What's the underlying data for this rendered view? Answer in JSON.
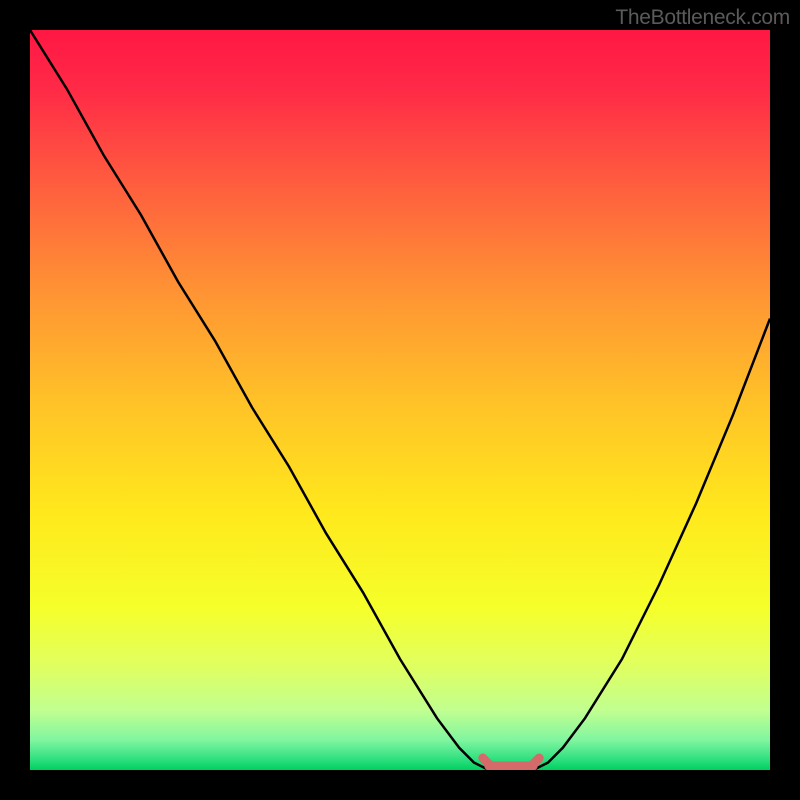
{
  "watermark": "TheBottleneck.com",
  "chart_data": {
    "type": "line",
    "title": "",
    "xlabel": "",
    "ylabel": "",
    "xlim": [
      0,
      100
    ],
    "ylim": [
      0,
      100
    ],
    "x": [
      0,
      5,
      10,
      15,
      20,
      25,
      30,
      35,
      40,
      45,
      50,
      55,
      58,
      60,
      62,
      64,
      66,
      68,
      70,
      72,
      75,
      80,
      85,
      90,
      95,
      100
    ],
    "y": [
      100,
      92,
      83,
      75,
      66,
      58,
      49,
      41,
      32,
      24,
      15,
      7,
      3,
      1,
      0,
      0,
      0,
      0,
      1,
      3,
      7,
      15,
      25,
      36,
      48,
      61
    ],
    "minimum_region": {
      "x_start": 62,
      "x_end": 68,
      "y": 0
    },
    "gradient_stops": [
      {
        "pos": 0.0,
        "color": "#ff1744"
      },
      {
        "pos": 0.08,
        "color": "#ff2a47"
      },
      {
        "pos": 0.2,
        "color": "#ff5a3f"
      },
      {
        "pos": 0.35,
        "color": "#ff9234"
      },
      {
        "pos": 0.5,
        "color": "#ffc128"
      },
      {
        "pos": 0.65,
        "color": "#ffe81c"
      },
      {
        "pos": 0.78,
        "color": "#f5ff2a"
      },
      {
        "pos": 0.86,
        "color": "#e0ff60"
      },
      {
        "pos": 0.92,
        "color": "#c0ff90"
      },
      {
        "pos": 0.96,
        "color": "#80f5a0"
      },
      {
        "pos": 0.985,
        "color": "#30e080"
      },
      {
        "pos": 1.0,
        "color": "#00d060"
      }
    ],
    "curve_color": "#000000",
    "marker_color": "#d46a6a"
  }
}
